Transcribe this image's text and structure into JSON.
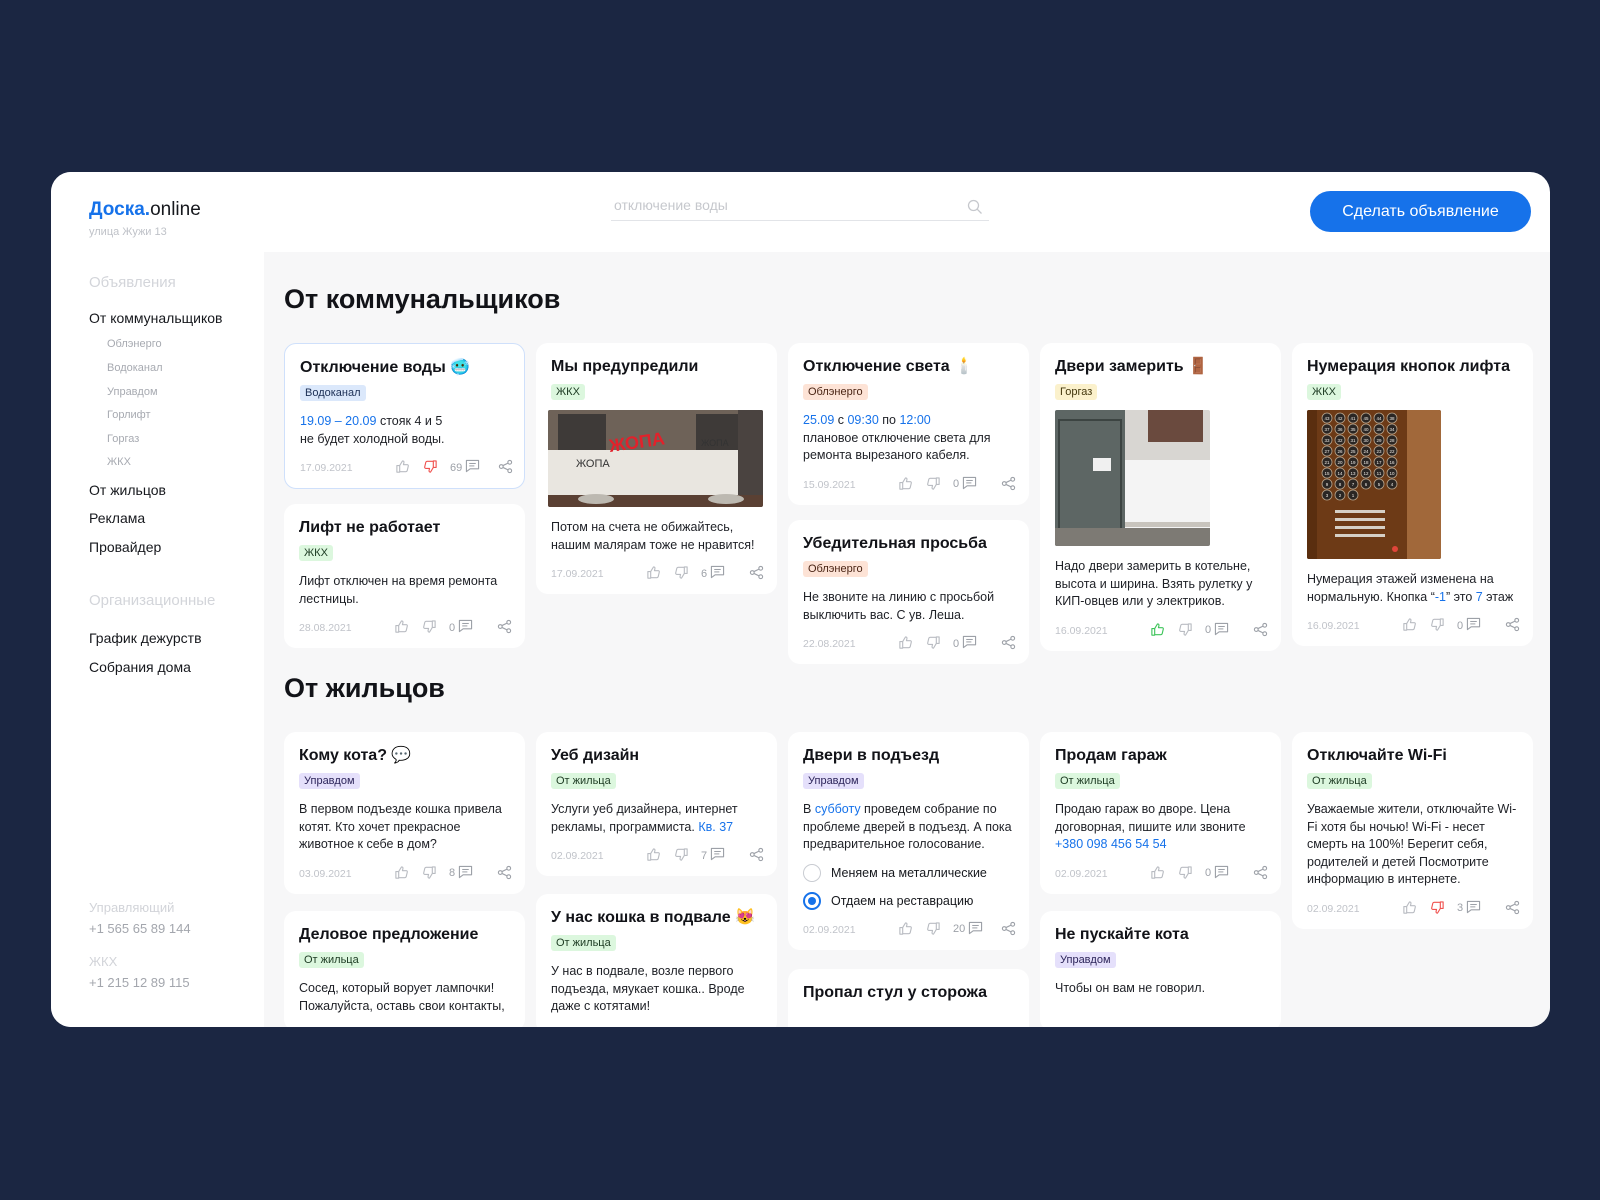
{
  "brand": {
    "name_bold": "Доска",
    "dot": ".",
    "name_rest": "online",
    "address": "улица Жужи 13"
  },
  "search": {
    "placeholder": "отключение воды"
  },
  "cta": {
    "label": "Сделать объявление"
  },
  "sidebar": {
    "heading1": "Объявления",
    "main_item": "От коммунальщиков",
    "sub_items": [
      "Облэнерго",
      "Водоканал",
      "Управдом",
      "Горлифт",
      "Горгаз",
      "ЖКХ"
    ],
    "items": [
      "От жильцов",
      "Реклама",
      "Провайдер"
    ],
    "heading2": "Организационные",
    "org_items": [
      "График дежурств",
      "Собрания дома"
    ],
    "contacts": [
      {
        "label": "Управляющий",
        "phone": "+1 565 65 89 144"
      },
      {
        "label": "ЖКХ",
        "phone": "+1 215 12 89 115"
      }
    ]
  },
  "sections": {
    "utility": "От коммунальщиков",
    "residents": "От жильцов"
  },
  "colors": {
    "accent": "#1672ea",
    "like_active": "#3ec45a",
    "dislike_active": "#f0524f"
  },
  "cards": {
    "c1": {
      "title": "Отключение воды 🥶",
      "tag": "Водоканал",
      "t_a": "19.09 – 20.09",
      "t_b": " стояк 4 и 5",
      "t_c": "не будет холодной воды.",
      "date": "17.09.2021",
      "comments": "69"
    },
    "c2": {
      "title": "Лифт не работает",
      "tag": "ЖКХ",
      "text": "Лифт отключен на время ремонта лестницы.",
      "date": "28.08.2021",
      "comments": "0"
    },
    "c3": {
      "title": "Мы предупредили",
      "tag": "ЖКХ",
      "text": "Потом на счета не обижайтесь, нашим малярам тоже не нравится!",
      "date": "17.09.2021",
      "comments": "6",
      "img_words": [
        "ЖОПА",
        "ЖОПА",
        "ЖОПА"
      ]
    },
    "c4": {
      "title": "Отключение света 🕯️",
      "tag": "Облэнерго",
      "d1": "25.09",
      "w1": " с ",
      "d2": "09:30",
      "w2": " по ",
      "d3": "12:00",
      "t_c": "плановое отключение света для ремонта вырезаного кабеля.",
      "date": "15.09.2021",
      "comments": "0"
    },
    "c5": {
      "title": "Убедительная просьба",
      "tag": "Облэнерго",
      "text": "Не звоните на линию с просьбой выключить вас. С ув. Леша.",
      "date": "22.08.2021",
      "comments": "0"
    },
    "c6": {
      "title": "Двери замерить 🚪",
      "tag": "Горгаз",
      "text": "Надо двери замерить в котельне, высота и ширина. Взять рулетку у КИП-овцев или у электриков.",
      "date": "16.09.2021",
      "comments": "0"
    },
    "c7": {
      "title": "Нумерация кнопок лифта",
      "tag": "ЖКХ",
      "t_a": "Нумерация этажей изменена на нормальную. Кнопка “",
      "t_b": "-1",
      "t_c": "” это ",
      "t_d": "7",
      "t_e": " этаж",
      "date": "16.09.2021",
      "comments": "0"
    },
    "r1": {
      "title": "Кому кота? 💬",
      "tag": "Управдом",
      "text": "В первом подъезде кошка привела котят. Кто хочет прекрасное животное к себе в дом?",
      "date": "03.09.2021",
      "comments": "8"
    },
    "r2": {
      "title": "Деловое предложение",
      "tag": "От жильца",
      "text": "Сосед, который ворует лампочки! Пожалуйста, оставь свои контакты,"
    },
    "r3": {
      "title": "Уеб дизайн",
      "tag": "От жильца",
      "text": "Услуги уеб дизайнера, интернет рекламы, программиста. ",
      "link": "Кв. 37",
      "date": "02.09.2021",
      "comments": "7"
    },
    "r4": {
      "title": "У нас кошка в подвале 😻",
      "tag": "От жильца",
      "text": "У нас в подвале, возле первого подъезда, мяукает кошка.. Вроде даже с котятами!"
    },
    "r5": {
      "title": "Двери в подъезд",
      "tag": "Управдом",
      "t_a": "В ",
      "link": "субботу",
      "t_b": " проведем собрание по проблеме дверей в подъезд. А пока предварительное голосование.",
      "opt1": "Меняем на металлические",
      "opt2": "Отдаем на реставрацию",
      "date": "02.09.2021",
      "comments": "20"
    },
    "r6": {
      "title": "Пропал стул у сторожа"
    },
    "r7": {
      "title": "Продам гараж",
      "tag": "От жильца",
      "text": "Продаю гараж во дворе. Цена договорная, пишите или звоните",
      "phone": "+380 098 456 54 54",
      "date": "02.09.2021",
      "comments": "0"
    },
    "r8": {
      "title": "Не пускайте кота",
      "tag": "Управдом",
      "text": "Чтобы он вам не говорил."
    },
    "r9": {
      "title": "Отключайте Wi-Fi",
      "tag": "От жильца",
      "text": "Уважаемые жители, отключайте Wi-Fi хотя бы ночью! Wi-Fi - несет смерть на 100%! Берегит себя, родителей и детей Посмотрите информацию в интернете.",
      "date": "02.09.2021",
      "comments": "3"
    }
  },
  "elevator_buttons": [
    "43",
    "42",
    "41",
    "45",
    "44",
    "38",
    "37",
    "36",
    "35",
    "40",
    "39",
    "34",
    "33",
    "32",
    "31",
    "30",
    "29",
    "28",
    "27",
    "26",
    "25",
    "24",
    "23",
    "22",
    "21",
    "20",
    "19",
    "18",
    "17",
    "16",
    "15",
    "14",
    "13",
    "12",
    "11",
    "10",
    "9",
    "8",
    "7",
    "6",
    "5",
    "4",
    "3",
    "2",
    "1"
  ]
}
